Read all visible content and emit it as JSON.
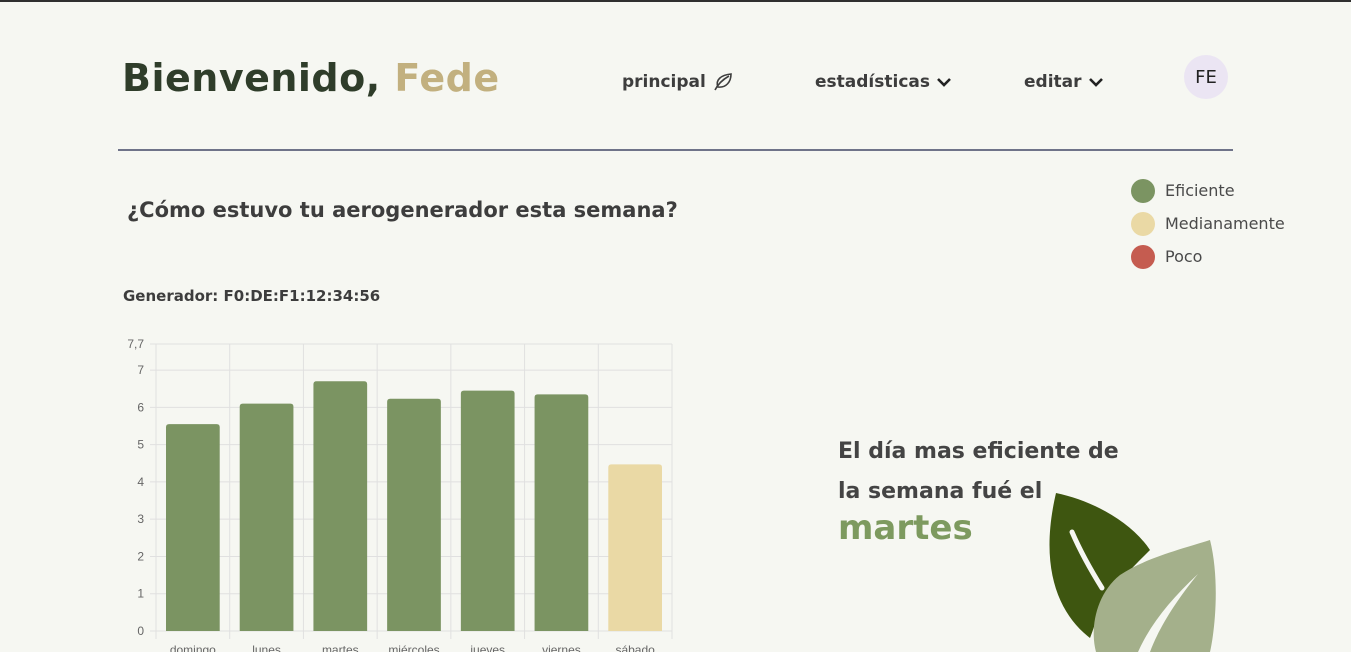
{
  "header": {
    "greeting": "Bienvenido,",
    "user_name": "Fede",
    "nav": {
      "principal": "principal",
      "estadisticas": "estadísticas",
      "editar": "editar"
    },
    "avatar_initials": "FE"
  },
  "legend": [
    {
      "label": "Eficiente",
      "color": "#7b9462"
    },
    {
      "label": "Medianamente",
      "color": "#ead9a5"
    },
    {
      "label": "Poco",
      "color": "#c55c50"
    }
  ],
  "question": "¿Cómo estuvo tu aerogenerador esta semana?",
  "generator_label": "Generador: F0:DE:F1:12:34:56",
  "summary": {
    "text": "El día mas eficiente de la semana fué el",
    "day": "martes"
  },
  "chart_data": {
    "type": "bar",
    "categories": [
      "domingo",
      "lunes",
      "martes",
      "miércoles",
      "jueves",
      "viernes",
      "sábado"
    ],
    "values": [
      5.55,
      6.1,
      6.7,
      6.23,
      6.45,
      6.35,
      4.47
    ],
    "bar_status": [
      "Eficiente",
      "Eficiente",
      "Eficiente",
      "Eficiente",
      "Eficiente",
      "Eficiente",
      "Medianamente"
    ],
    "bar_colors": [
      "#7b9462",
      "#7b9462",
      "#7b9462",
      "#7b9462",
      "#7b9462",
      "#7b9462",
      "#ead9a5"
    ],
    "yticks": [
      "0",
      "1",
      "2",
      "3",
      "4",
      "5",
      "6",
      "7",
      "7,7"
    ],
    "ylim": [
      0,
      7.7
    ],
    "title": "",
    "xlabel": "",
    "ylabel": "",
    "grid": true
  }
}
